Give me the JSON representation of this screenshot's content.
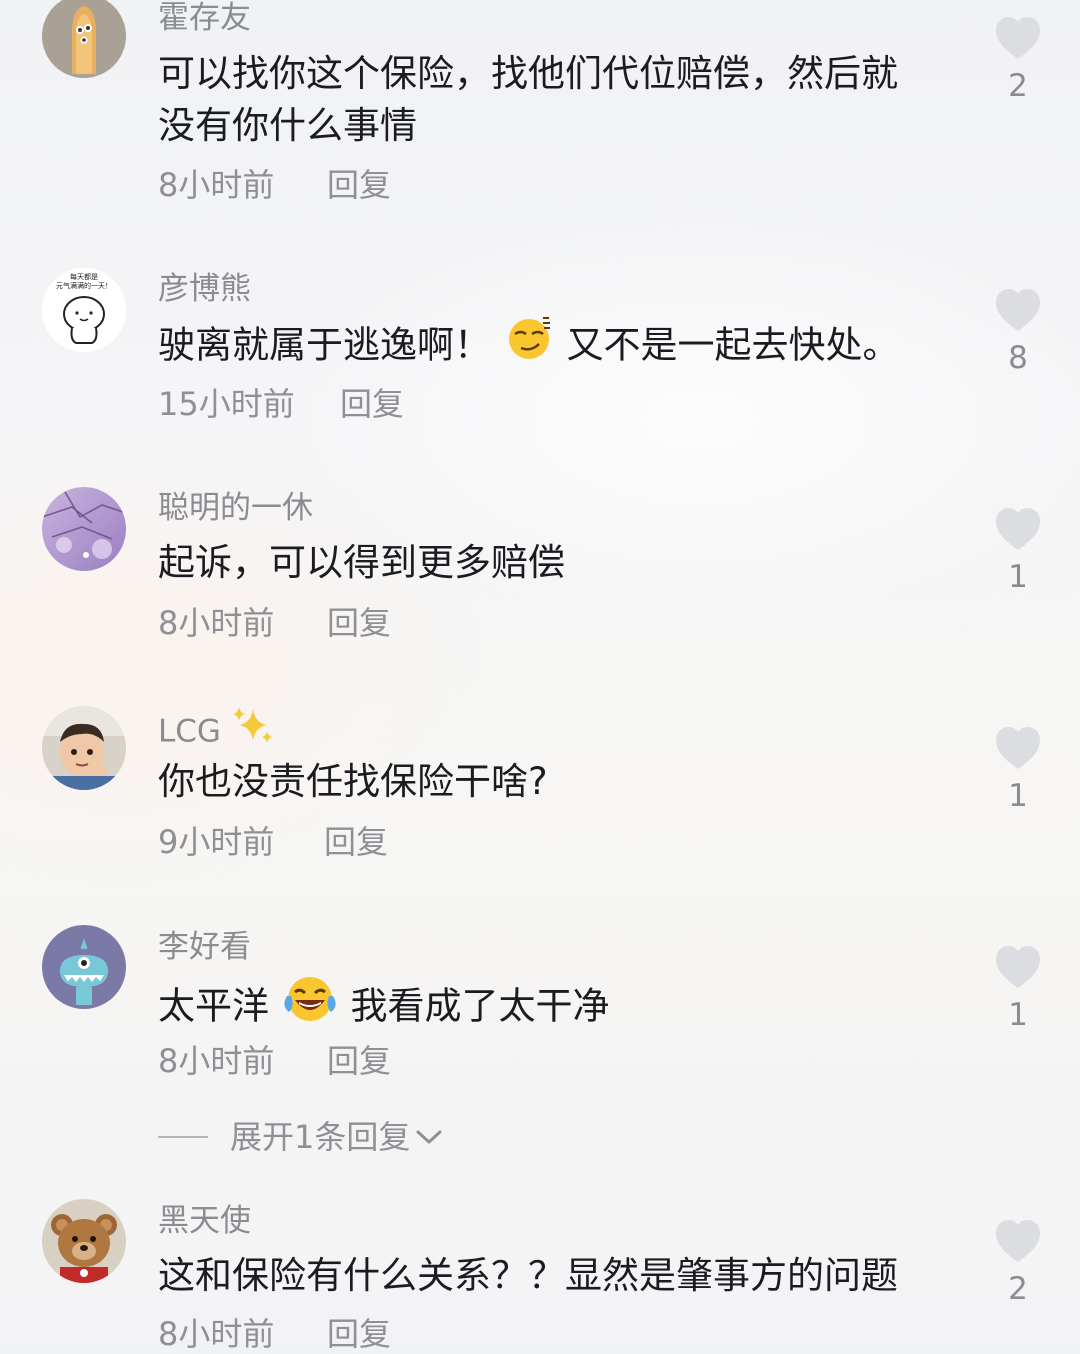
{
  "comments": [
    {
      "username": "霍存友",
      "lines": [
        "可以找你这个保险，找他们代位赔偿，然后就",
        "没有你什么事情"
      ],
      "time": "8小时前",
      "reply": "回复",
      "likes": "2"
    },
    {
      "username": "彦博熊",
      "text_before": "驶离就属于逃逸啊！",
      "emoji": "smirk-emoji",
      "text_after": "又不是一起去快处。",
      "time": "15小时前",
      "reply": "回复",
      "likes": "8",
      "avatar_caption": [
        "每天都是",
        "元气满满的一天！"
      ]
    },
    {
      "username": "聪明的一休",
      "text": "起诉，可以得到更多赔偿",
      "time": "8小时前",
      "reply": "回复",
      "likes": "1"
    },
    {
      "username": "LCG",
      "name_emoji": "sparkles-emoji",
      "text": "你也没责任找保险干啥?",
      "time": "9小时前",
      "reply": "回复",
      "likes": "1"
    },
    {
      "username": "李好看",
      "text_before": "太平洋",
      "emoji": "laughing-tears-emoji",
      "text_after": "我看成了太干净",
      "time": "8小时前",
      "reply": "回复",
      "likes": "1",
      "expand_label": "展开1条回复"
    },
    {
      "username": "黑天使",
      "text": "这和保险有什么关系？？显然是肇事方的问题",
      "time": "8小时前",
      "reply": "回复",
      "likes": "2"
    }
  ],
  "icons": {
    "like": "heart-icon",
    "expand": "chevron-down-icon"
  },
  "colors": {
    "text": "#1b1c21",
    "muted": "#8e9095",
    "heart": "#dcdde0"
  }
}
